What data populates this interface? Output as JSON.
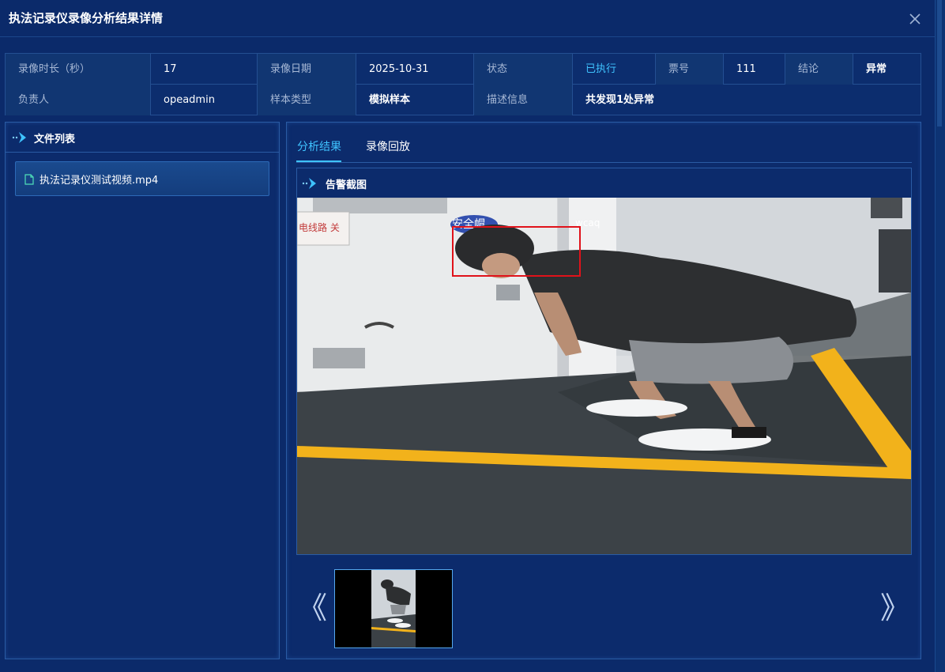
{
  "modal": {
    "title": "执法记录仪录像分析结果详情"
  },
  "info": {
    "row1": [
      {
        "label": "录像时长（秒）",
        "value": "17"
      },
      {
        "label": "录像日期",
        "value": "2025-10-31"
      },
      {
        "label": "状态",
        "value": "已执行"
      },
      {
        "label": "票号",
        "value": "111"
      },
      {
        "label": "结论",
        "value": "异常"
      }
    ],
    "row2": [
      {
        "label": "负责人",
        "value": "opeadmin"
      },
      {
        "label": "样本类型",
        "value": "模拟样本"
      },
      {
        "label": "描述信息",
        "value": "共发现1处异常"
      }
    ]
  },
  "file_panel": {
    "title": "文件列表",
    "files": [
      {
        "name": "执法记录仪测试视频.mp4"
      }
    ]
  },
  "result_panel": {
    "tabs": [
      {
        "label": "分析结果",
        "active": true
      },
      {
        "label": "录像回放",
        "active": false
      }
    ],
    "alarm_title": "告警截图",
    "image_text": {
      "sign": "电线路 关",
      "banner": "安全帽",
      "mark": "wcaq"
    },
    "prev": "《",
    "next": "》"
  },
  "colors": {
    "accent": "#3fc3ff",
    "background": "#0b2a6a",
    "alarm_box": "#e0121a",
    "floor_line": "#f2b21b"
  }
}
